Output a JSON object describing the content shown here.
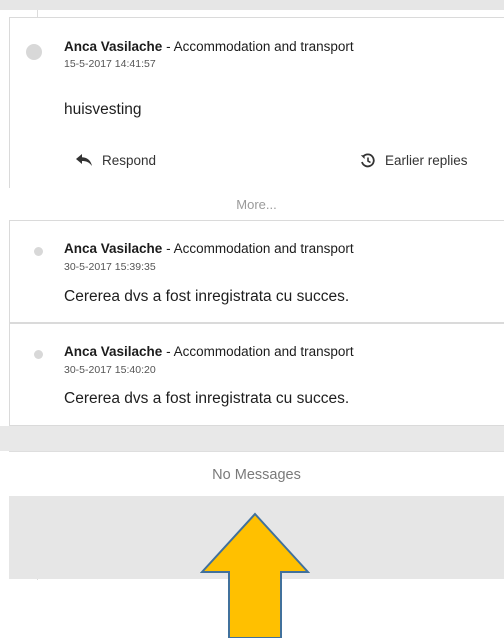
{
  "thread": {
    "first": {
      "author": "Anca Vasilache",
      "category": " - Accommodation and transport",
      "date": "15-5-2017 14:41:57",
      "message": "huisvesting",
      "respond_label": "Respond",
      "earlier_label": "Earlier replies"
    },
    "more_label": "More...",
    "replies": [
      {
        "author": "Anca Vasilache",
        "category": " - Accommodation and transport",
        "date": "30-5-2017 15:39:35",
        "message": "Cererea dvs a fost inregistrata cu succes."
      },
      {
        "author": "Anca Vasilache",
        "category": " - Accommodation and transport",
        "date": "30-5-2017 15:40:20",
        "message": "Cererea dvs a fost inregistrata cu succes."
      }
    ],
    "no_messages_label": "No Messages"
  },
  "colors": {
    "arrow_fill": "#ffc000",
    "arrow_stroke": "#41719c",
    "band_gray": "#e6e6e6"
  },
  "icons": {
    "respond": "reply-icon",
    "earlier": "history-icon"
  }
}
